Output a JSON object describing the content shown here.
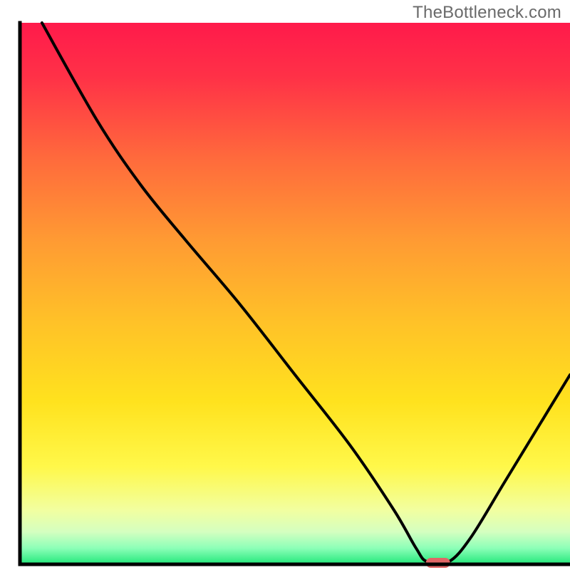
{
  "watermark": "TheBottleneck.com",
  "chart_data": {
    "type": "line",
    "title": "",
    "xlabel": "",
    "ylabel": "",
    "xlim": [
      0,
      100
    ],
    "ylim": [
      0,
      100
    ],
    "grid": false,
    "legend": false,
    "marker": {
      "x": 76,
      "y": 0,
      "color": "#e06666",
      "shape": "rounded-rect"
    },
    "curve": [
      {
        "x": 4,
        "y": 100
      },
      {
        "x": 14,
        "y": 82
      },
      {
        "x": 22,
        "y": 70
      },
      {
        "x": 30,
        "y": 60
      },
      {
        "x": 40,
        "y": 48
      },
      {
        "x": 50,
        "y": 35
      },
      {
        "x": 60,
        "y": 22
      },
      {
        "x": 68,
        "y": 10
      },
      {
        "x": 72,
        "y": 3
      },
      {
        "x": 74,
        "y": 0.5
      },
      {
        "x": 78,
        "y": 0.5
      },
      {
        "x": 82,
        "y": 5
      },
      {
        "x": 88,
        "y": 15
      },
      {
        "x": 94,
        "y": 25
      },
      {
        "x": 100,
        "y": 35
      }
    ],
    "background_gradient": {
      "stops": [
        {
          "offset": 0.0,
          "color": "#ff1a4b"
        },
        {
          "offset": 0.1,
          "color": "#ff3147"
        },
        {
          "offset": 0.25,
          "color": "#ff6a3c"
        },
        {
          "offset": 0.4,
          "color": "#ff9a33"
        },
        {
          "offset": 0.55,
          "color": "#ffc128"
        },
        {
          "offset": 0.7,
          "color": "#ffe21e"
        },
        {
          "offset": 0.82,
          "color": "#fff84a"
        },
        {
          "offset": 0.9,
          "color": "#f2ffa0"
        },
        {
          "offset": 0.94,
          "color": "#d4ffc0"
        },
        {
          "offset": 0.97,
          "color": "#8dffb8"
        },
        {
          "offset": 1.0,
          "color": "#22e87a"
        }
      ]
    },
    "axis": {
      "color": "#000000",
      "width": 5
    }
  }
}
